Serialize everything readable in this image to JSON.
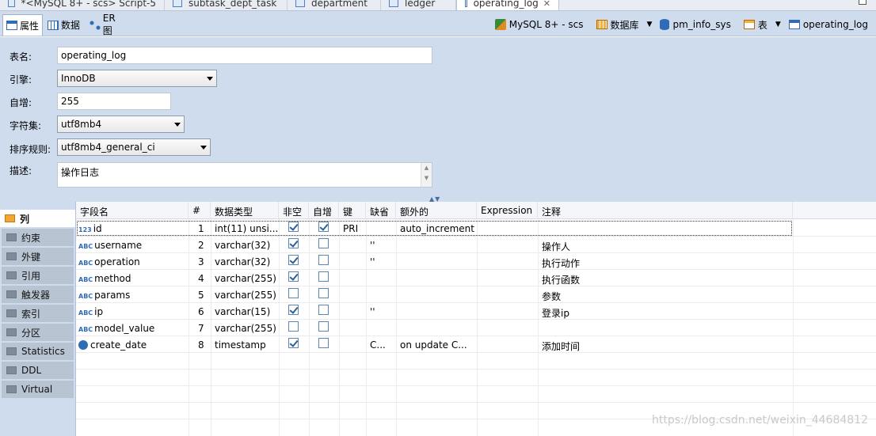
{
  "editor_tabs": [
    {
      "label": "*<MySQL 8+ - scs> Script-5",
      "active": false
    },
    {
      "label": "subtask_dept_task",
      "active": false
    },
    {
      "label": "department",
      "active": false
    },
    {
      "label": "ledger",
      "active": false
    },
    {
      "label": "operating_log",
      "active": true,
      "close": "✕"
    }
  ],
  "sub_tabs": [
    {
      "label": "属性",
      "icon": "properties-icon"
    },
    {
      "label": "数据",
      "icon": "data-icon"
    },
    {
      "label": "ER 图",
      "icon": "er-diagram-icon"
    }
  ],
  "breadcrumb": {
    "connection": "MySQL 8+ - scs",
    "database_label": "数据库",
    "database": "pm_info_sys",
    "table_label": "表",
    "table": "operating_log"
  },
  "form": {
    "table_name_label": "表名:",
    "table_name": "operating_log",
    "engine_label": "引擎:",
    "engine": "InnoDB",
    "auto_inc_label": "自增:",
    "auto_inc": "255",
    "charset_label": "字符集:",
    "charset": "utf8mb4",
    "collation_label": "排序规则:",
    "collation": "utf8mb4_general_ci",
    "desc_label": "描述:",
    "desc": "操作日志"
  },
  "nav": [
    {
      "label": "列",
      "icon": "columns-icon",
      "active": true
    },
    {
      "label": "约束",
      "icon": "constraints-icon"
    },
    {
      "label": "外键",
      "icon": "foreign-keys-icon"
    },
    {
      "label": "引用",
      "icon": "references-icon"
    },
    {
      "label": "触发器",
      "icon": "triggers-icon"
    },
    {
      "label": "索引",
      "icon": "indexes-icon"
    },
    {
      "label": "分区",
      "icon": "partitions-icon"
    },
    {
      "label": "Statistics",
      "icon": "statistics-icon"
    },
    {
      "label": "DDL",
      "icon": "ddl-icon"
    },
    {
      "label": "Virtual",
      "icon": "virtual-icon"
    }
  ],
  "columns_header": [
    "字段名",
    "#",
    "数据类型",
    "非空",
    "自增",
    "键",
    "缺省",
    "额外的",
    "Expression",
    "注释"
  ],
  "rows": [
    {
      "type_icon": "123",
      "name": "id",
      "num": "1",
      "dtype": "int(11) unsi...",
      "notnull": true,
      "autoinc": true,
      "key": "PRI",
      "default": "",
      "extra": "auto_increment",
      "expr": "",
      "comment": ""
    },
    {
      "type_icon": "ABC",
      "name": "username",
      "num": "2",
      "dtype": "varchar(32)",
      "notnull": true,
      "autoinc": false,
      "key": "",
      "default": "''",
      "extra": "",
      "expr": "",
      "comment": "操作人"
    },
    {
      "type_icon": "ABC",
      "name": "operation",
      "num": "3",
      "dtype": "varchar(32)",
      "notnull": true,
      "autoinc": false,
      "key": "",
      "default": "''",
      "extra": "",
      "expr": "",
      "comment": "执行动作"
    },
    {
      "type_icon": "ABC",
      "name": "method",
      "num": "4",
      "dtype": "varchar(255)",
      "notnull": true,
      "autoinc": false,
      "key": "",
      "default": "",
      "extra": "",
      "expr": "",
      "comment": "执行函数"
    },
    {
      "type_icon": "ABC",
      "name": "params",
      "num": "5",
      "dtype": "varchar(255)",
      "notnull": false,
      "autoinc": false,
      "key": "",
      "default": "",
      "extra": "",
      "expr": "",
      "comment": "参数"
    },
    {
      "type_icon": "ABC",
      "name": "ip",
      "num": "6",
      "dtype": "varchar(15)",
      "notnull": true,
      "autoinc": false,
      "key": "",
      "default": "''",
      "extra": "",
      "expr": "",
      "comment": "登录ip"
    },
    {
      "type_icon": "ABC",
      "name": "model_value",
      "num": "7",
      "dtype": "varchar(255)",
      "notnull": false,
      "autoinc": false,
      "key": "",
      "default": "",
      "extra": "",
      "expr": "",
      "comment": ""
    },
    {
      "type_icon": "clock",
      "name": "create_date",
      "num": "8",
      "dtype": "timestamp",
      "notnull": true,
      "autoinc": false,
      "key": "",
      "default": "C...",
      "extra": "on update C...",
      "expr": "",
      "comment": "添加时间"
    }
  ],
  "watermark": "https://blog.csdn.net/weixin_44684812"
}
